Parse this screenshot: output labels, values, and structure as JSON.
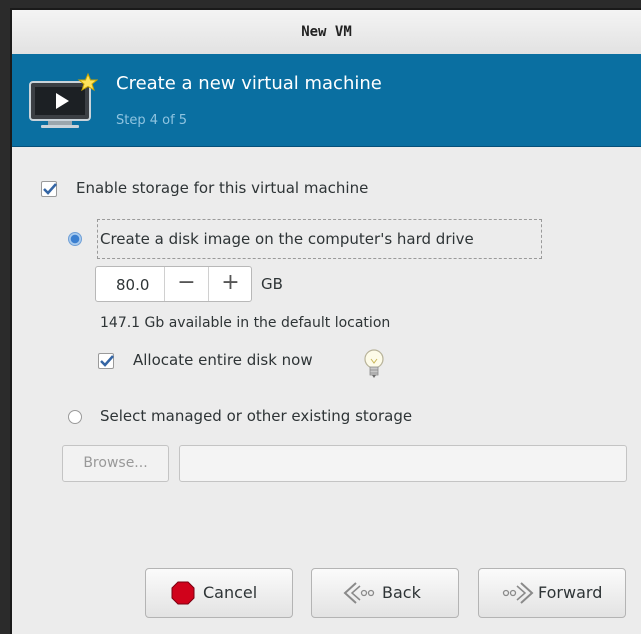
{
  "window": {
    "title": "New VM"
  },
  "header": {
    "title": "Create a new virtual machine",
    "step": "Step 4 of 5"
  },
  "storage": {
    "enable_label": "Enable storage for this virtual machine",
    "enable_checked": true,
    "create_disk_label": "Create a disk image on the computer's hard drive",
    "create_disk_selected": true,
    "disk_size": "80.0",
    "minus_label": "−",
    "plus_label": "+",
    "size_unit": "GB",
    "available_text": "147.1 Gb available in the default location",
    "allocate_label": "Allocate entire disk now",
    "allocate_checked": true,
    "managed_label": "Select managed or other existing storage",
    "managed_selected": false,
    "browse_label": "Browse...",
    "path_value": ""
  },
  "buttons": {
    "cancel": "Cancel",
    "back": "Back",
    "forward": "Forward"
  },
  "colors": {
    "banner": "#0a6fa1",
    "step_text": "#8fc4e0",
    "cancel_icon": "#d0021b"
  }
}
